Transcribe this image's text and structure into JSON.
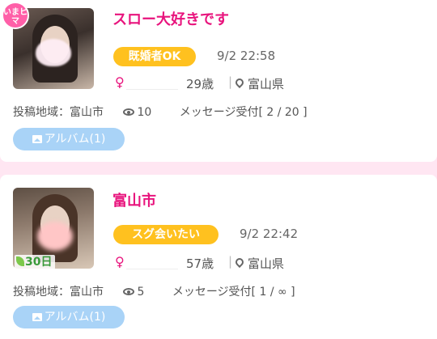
{
  "posts": [
    {
      "badge": "いまヒマ",
      "title": "スロー大好きです",
      "tag": "既婚者OK",
      "datetime": "9/2 22:58",
      "gender": "♀",
      "age": "29歳",
      "separator": "|",
      "prefecture": "富山県",
      "region": "投稿地域：富山市",
      "views": "10",
      "messages": "メッセージ受付[ 2 / 20 ]",
      "album": "アルバム(1)",
      "colors": {
        "title": "#e8147d",
        "tag": "#ffc11f",
        "album": "#a9d3f7"
      }
    },
    {
      "days_badge": "30日",
      "title": "富山市",
      "tag": "スグ会いたい",
      "datetime": "9/2 22:42",
      "gender": "♀",
      "age": "57歳",
      "separator": "|",
      "prefecture": "富山県",
      "region": "投稿地域：富山市",
      "views": "5",
      "messages": "メッセージ受付[ 1 / ∞ ]",
      "album": "アルバム(1)",
      "colors": {
        "title": "#e8147d",
        "tag": "#ffc11f",
        "album": "#a9d3f7"
      }
    }
  ],
  "icons": {
    "gender": "female-symbol-icon",
    "location": "map-pin-icon",
    "views": "eye-icon",
    "album": "image-icon"
  }
}
